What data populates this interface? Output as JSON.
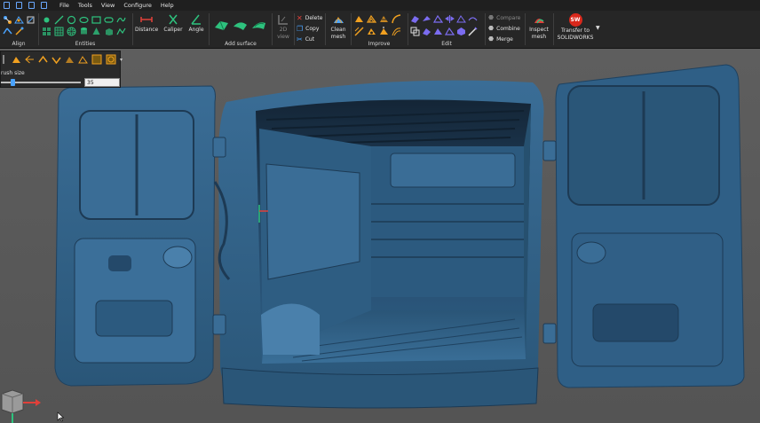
{
  "menu": [
    "File",
    "Tools",
    "View",
    "Configure",
    "Help"
  ],
  "ribbon": {
    "groups": {
      "align": "Align",
      "entities": "Entities",
      "add_surface": "Add surface",
      "improve": "Improve",
      "edit": "Edit"
    },
    "buttons": {
      "distance": "Distance",
      "caliper": "Caliper",
      "angle": "Angle",
      "view_2d": "2D",
      "view_2d_sub": "view",
      "delete": "Delete",
      "copy": "Copy",
      "cut": "Cut",
      "clean": "Clean",
      "clean_sub": "mesh",
      "compare": "Compare",
      "combine": "Combine",
      "merge": "Merge",
      "inspect": "Inspect",
      "inspect_sub": "mesh",
      "transfer": "Transfer to",
      "transfer_sub": "SOLIDWORKS",
      "sw_logo": "SW"
    }
  },
  "brush": {
    "label": "rush size",
    "value": "35",
    "slider_fraction": 0.15
  },
  "colors": {
    "mesh": "#2f5f86",
    "accent": "#4aa3ff",
    "viewport": "#5b5b5b"
  }
}
